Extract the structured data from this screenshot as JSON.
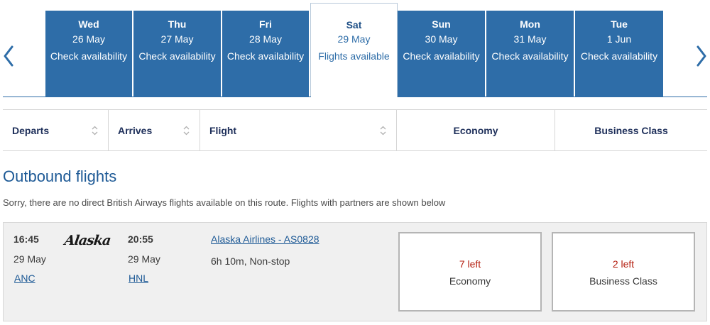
{
  "date_strip": {
    "days": [
      {
        "day": "Wed",
        "date": "26 May",
        "status": "Check availability"
      },
      {
        "day": "Thu",
        "date": "27 May",
        "status": "Check availability"
      },
      {
        "day": "Fri",
        "date": "28 May",
        "status": "Check availability"
      },
      {
        "day": "Sat",
        "date": "29 May",
        "status": "Flights available"
      },
      {
        "day": "Sun",
        "date": "30 May",
        "status": "Check availability"
      },
      {
        "day": "Mon",
        "date": "31 May",
        "status": "Check availability"
      },
      {
        "day": "Tue",
        "date": "1 Jun",
        "status": "Check availability"
      }
    ],
    "selected_index": 3,
    "prev_icon": "chevron-left-icon",
    "next_icon": "chevron-right-icon"
  },
  "sort_bar": {
    "departs": "Departs",
    "arrives": "Arrives",
    "flight": "Flight",
    "economy": "Economy",
    "business": "Business Class"
  },
  "outbound": {
    "title": "Outbound flights",
    "notice": "Sorry, there are no direct British Airways flights available on this route. Flights with partners are shown below"
  },
  "flight": {
    "departure_time": "16:45",
    "departure_date": "29 May",
    "departure_airport": "ANC",
    "airline_logo_text": "Alaska",
    "arrival_time": "20:55",
    "arrival_date": "29 May",
    "arrival_airport": "HNL",
    "flight_name": "Alaska Airlines - AS0828",
    "duration": "6h 10m, Non-stop",
    "fares": {
      "economy": {
        "seats": "7 left",
        "cabin": "Economy"
      },
      "business": {
        "seats": "2 left",
        "cabin": "Business Class"
      }
    }
  },
  "colors": {
    "brand_blue": "#2e6da8",
    "link_blue": "#1e5a96",
    "seats_red": "#b41e0f",
    "card_bg": "#f0f0f0"
  }
}
